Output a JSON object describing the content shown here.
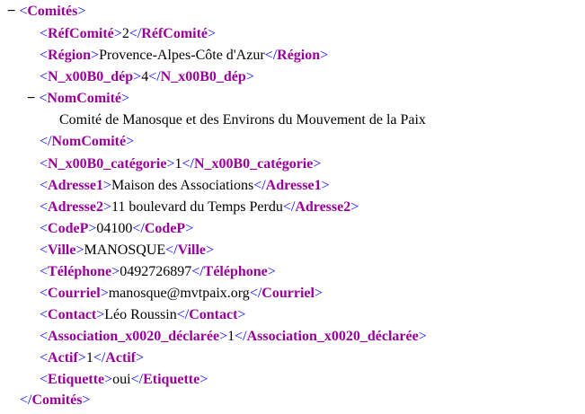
{
  "toggles": {
    "root": "−",
    "nom": "−"
  },
  "brackets": {
    "open": "<",
    "close": ">",
    "open_end": "</"
  },
  "root_tag": "Comités",
  "nom_block": {
    "tag": "NomComité",
    "text": "Comité de Manosque et des Environs du Mouvement de la Paix"
  },
  "elements": [
    {
      "tag": "RéfComité",
      "value": "2"
    },
    {
      "tag": "Région",
      "value": "Provence-Alpes-Côte d'Azur"
    },
    {
      "tag": "N_x00B0_dép",
      "value": "4"
    },
    {
      "tag": "N_x00B0_catégorie",
      "value": "1"
    },
    {
      "tag": "Adresse1",
      "value": "Maison des Associations"
    },
    {
      "tag": "Adresse2",
      "value": "11 boulevard du Temps Perdu"
    },
    {
      "tag": "CodeP",
      "value": "04100"
    },
    {
      "tag": "Ville",
      "value": "MANOSQUE"
    },
    {
      "tag": "Téléphone",
      "value": "0492726897"
    },
    {
      "tag": "Courriel",
      "value": "manosque@mvtpaix.org"
    },
    {
      "tag": "Contact",
      "value": "Léo Roussin"
    },
    {
      "tag": "Association_x0020_déclarée",
      "value": "1"
    },
    {
      "tag": "Actif",
      "value": "1"
    },
    {
      "tag": "Etiquette",
      "value": "oui"
    }
  ]
}
